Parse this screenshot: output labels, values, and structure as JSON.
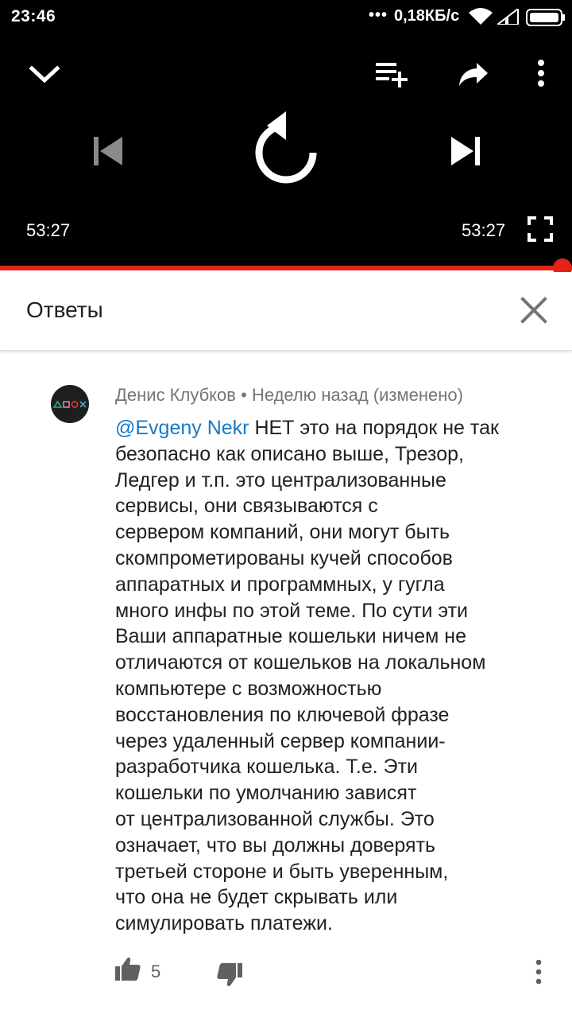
{
  "status_bar": {
    "time": "23:46",
    "dots": "•••",
    "speed": "0,18КБ/с"
  },
  "player": {
    "current_time": "53:27",
    "duration": "53:27",
    "progress_fraction": 1.0,
    "accent_color": "#e62117",
    "icons": [
      "collapse-chevron-icon",
      "add-to-playlist-icon",
      "share-icon",
      "more-vert-icon",
      "previous-icon",
      "replay-icon",
      "next-icon",
      "fullscreen-icon"
    ]
  },
  "replies": {
    "title": "Ответы"
  },
  "comment": {
    "author": "Денис Клубков",
    "separator": "•",
    "when": "Неделю назад (изменено)",
    "mention": "@Evgeny Nekr",
    "lines": [
      " НЕТ это на порядок не так",
      "безопасно как описано выше, Трезор,",
      "Ледгер и т.п. это централизованные",
      "сервисы, они связываются с",
      "сервером компаний, они могут быть",
      "скомпрометированы кучей способов",
      "аппаратных и программных, у гугла",
      "много инфы по этой теме. По сути эти",
      "Ваши аппаратные кошельки ничем не",
      "отличаются от кошельков на локальном",
      "компьютере с возможностью",
      "восстановления по ключевой фразе",
      "через удаленный сервер компании-",
      "разработчика кошелька. Т.е. Эти",
      "кошельки по умолчанию зависят",
      "от централизованной службы. Это",
      "означает, что вы должны доверять",
      "третьей стороне и быть уверенным,",
      "что она не будет скрывать или",
      "симулировать платежи."
    ],
    "likes": "5",
    "mention_color": "#167ac6"
  }
}
